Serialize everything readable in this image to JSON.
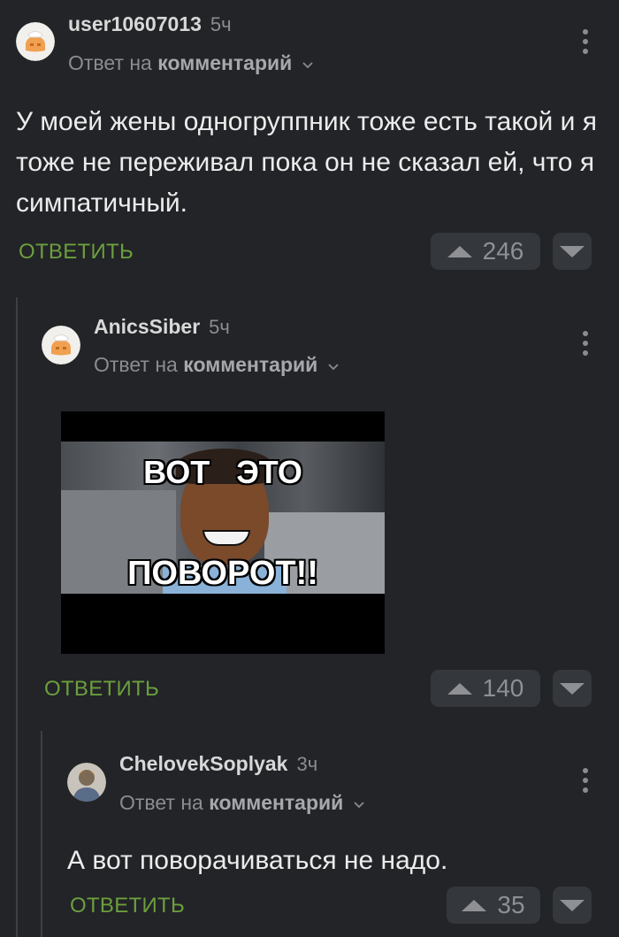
{
  "comments": [
    {
      "username": "user10607013",
      "time": "5ч",
      "reply_prefix": "Ответ на",
      "reply_target": "комментарий",
      "text": "У моей жены одногруппник тоже есть такой и я тоже не переживал пока он не сказал ей, что я симпатичный.",
      "reply_label": "ОТВЕТИТЬ",
      "votes": "246"
    },
    {
      "username": "AnicsSiber",
      "time": "5ч",
      "reply_prefix": "Ответ на",
      "reply_target": "комментарий",
      "meme_top": "ВОТ   ЭТО",
      "meme_bottom": "ПОВОРОТ!!",
      "reply_label": "ОТВЕТИТЬ",
      "votes": "140"
    },
    {
      "username": "ChelovekSoplyak",
      "time": "3ч",
      "reply_prefix": "Ответ на",
      "reply_target": "комментарий",
      "text": "А вот поворачиваться не надо.",
      "reply_label": "ОТВЕТИТЬ",
      "votes": "35"
    }
  ],
  "icons": {
    "upvote": "triangle-up-icon",
    "downvote": "triangle-down-icon",
    "more": "kebab-icon",
    "chevron": "chevron-down-icon"
  },
  "colors": {
    "background": "#222427",
    "reply_green": "#6c9e3e",
    "vote_box": "#34373b"
  }
}
